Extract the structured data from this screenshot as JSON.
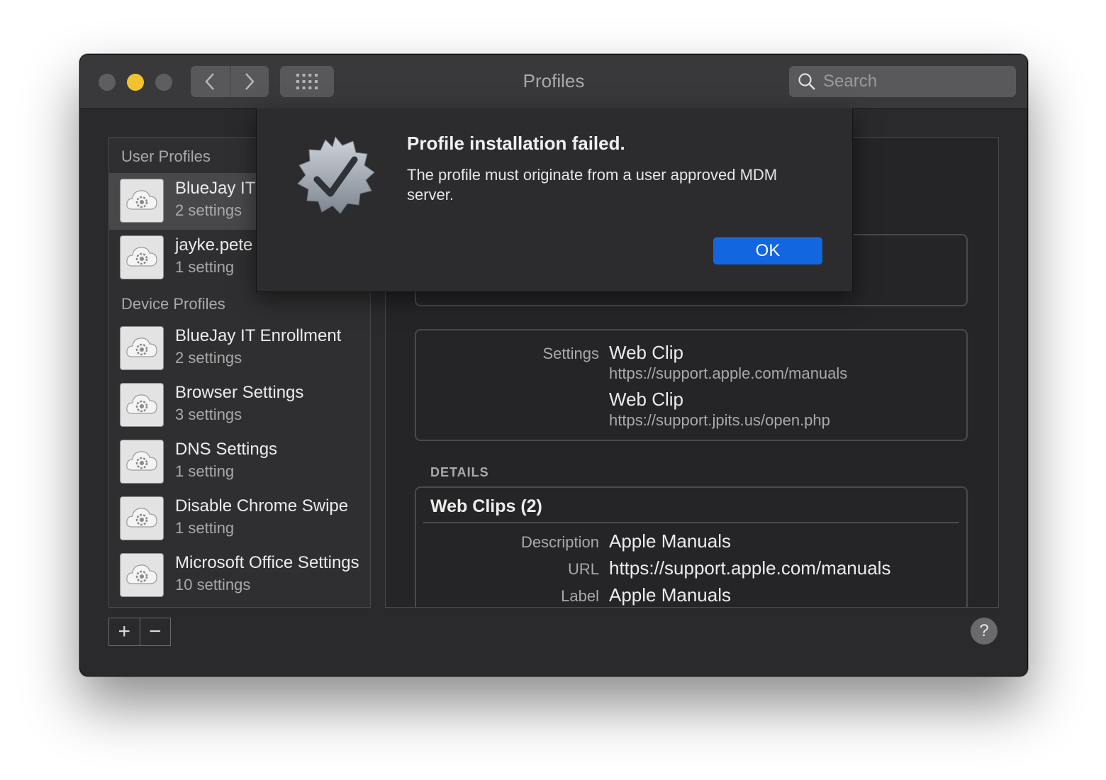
{
  "window": {
    "title": "Profiles"
  },
  "toolbar": {
    "back_icon": "chevron-left-icon",
    "forward_icon": "chevron-right-icon",
    "grid_icon": "grid-icon",
    "search_placeholder": "Search"
  },
  "sidebar": {
    "user_profiles_label": "User Profiles",
    "device_profiles_label": "Device Profiles",
    "user_profiles": [
      {
        "name": "BlueJay IT",
        "settings": "2 settings",
        "selected": true
      },
      {
        "name": "jayke.pete",
        "settings": "1 setting",
        "selected": false
      }
    ],
    "device_profiles": [
      {
        "name": "BlueJay IT Enrollment",
        "settings": "2 settings"
      },
      {
        "name": "Browser Settings",
        "settings": "3 settings"
      },
      {
        "name": "DNS Settings",
        "settings": "1 setting"
      },
      {
        "name": "Disable Chrome Swipe",
        "settings": "1 setting"
      },
      {
        "name": "Microsoft Office Settings",
        "settings": "10 settings"
      }
    ]
  },
  "main": {
    "settings_label": "Settings",
    "settings_items": [
      {
        "title": "Web Clip",
        "url": "https://support.apple.com/manuals"
      },
      {
        "title": "Web Clip",
        "url": "https://support.jpits.us/open.php"
      }
    ],
    "details_label": "DETAILS",
    "webclips_title": "Web Clips (2)",
    "webclip_fields": [
      {
        "label": "Description",
        "value": "Apple Manuals"
      },
      {
        "label": "URL",
        "value": "https://support.apple.com/manuals"
      },
      {
        "label": "Label",
        "value": "Apple Manuals"
      }
    ]
  },
  "bottom": {
    "add_label": "+",
    "remove_label": "−",
    "help_label": "?"
  },
  "alert": {
    "title": "Profile installation failed.",
    "message": "The profile must originate from a user approved MDM server.",
    "ok_label": "OK"
  },
  "colors": {
    "accent": "#1266e0",
    "minimize": "#f2c230",
    "window_bg": "#2a2a2c"
  }
}
